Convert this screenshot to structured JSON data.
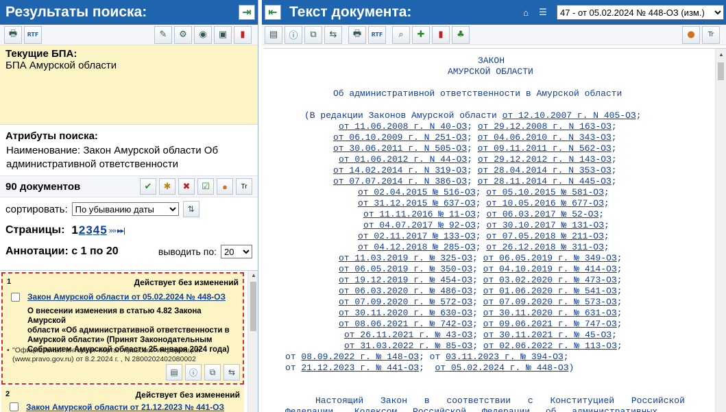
{
  "left": {
    "title": "Результаты поиска:",
    "bpa_label": "Текущие БПА:",
    "bpa_value": "БПА Амурской области",
    "attrs_label": "Атрибуты поиска:",
    "attrs_value_1": "Наименование: Закон Амурской области Об",
    "attrs_value_2": "административной ответственности",
    "count": "90 документов",
    "sort_label": "сортировать:",
    "sort_value": "По убыванию даты",
    "pages_label": "Страницы:",
    "pages": [
      "1",
      "2",
      "3",
      "4",
      "5"
    ],
    "pages_arrows": "»» ▸▸|",
    "ann_label": "Аннотации: с 1 по 20",
    "per_page_label": "выводить по:",
    "per_page_value": "20"
  },
  "results": [
    {
      "num": "1",
      "status": "Действует без изменений",
      "title": "Закон Амурской области от 05.02.2024 № 448-ОЗ",
      "desc_1": "О внесении изменения в статью 4.82 Закона Амурской",
      "desc_2": "области «Об административной ответственности в",
      "desc_3": "Амурской области» (Принят Законодательным",
      "desc_4": "Собранием Амурской области 25 января 2024 года)",
      "src_1": "\"Официальный интернет-портал правовой информации\"",
      "src_2": "(www.pravo.gov.ru) от 8.2.2024 г. , N 2800202402080002"
    },
    {
      "num": "2",
      "status": "Действует без изменений",
      "title": "Закон Амурской области от 21.12.2023 № 441-ОЗ"
    }
  ],
  "right": {
    "title": "Текст документа:",
    "doc_select": "47 - от 05.02.2024 № 448-ОЗ (изм.)",
    "law_title_1": "ЗАКОН",
    "law_title_2": "АМУРСКОЙ ОБЛАСТИ",
    "law_name": "Об административной ответственности в Амурской области",
    "editions_prefix": "(В редакции Законов Амурской области ",
    "editions": [
      "от 12.10.2007 г. N 405-ОЗ",
      "от 11.06.2008 г. N 40-ОЗ",
      "от 29.12.2008 г. N 163-ОЗ",
      "от 06.10.2009 г. N 251-ОЗ",
      "от 04.06.2010 г. N 343-ОЗ",
      "от 30.06.2011 г. N 505-ОЗ",
      "от 09.11.2011 г. N 562-ОЗ",
      "от 01.06.2012 г. N 44-ОЗ",
      "от 29.12.2012 г. N 143-ОЗ",
      "от 14.02.2014 г. N 319-ОЗ",
      "от 28.04.2014 г. N 353-ОЗ",
      "от 07.07.2014 г. N 386-ОЗ",
      "от 28.11.2014 г. N 445-ОЗ",
      "от 02.04.2015 № 516-ОЗ",
      "от 05.10.2015 № 581-ОЗ",
      "от 31.12.2015 № 637-ОЗ",
      "от 10.05.2016 № 677-ОЗ",
      "от 11.11.2016 № 11-ОЗ",
      "от 06.03.2017 № 52-ОЗ",
      "от 04.07.2017 № 92-ОЗ",
      "от 30.10.2017 № 131-ОЗ",
      "от 02.11.2017 № 133-ОЗ",
      "от 07.05.2018 № 211-ОЗ",
      "от 04.12.2018 № 285-ОЗ",
      "от 26.12.2018 № 311-ОЗ",
      "от 11.03.2019 г. № 325-ОЗ",
      "от 06.05.2019 г. № 349-ОЗ",
      "от 06.05.2019 г. № 350-ОЗ",
      "от 04.10.2019 г. № 414-ОЗ",
      "от 19.12.2019 г. № 454-ОЗ",
      "от 03.02.2020 г. № 473-ОЗ",
      "от 06.03.2020 г. № 486-ОЗ",
      "от 01.06.2020 г. № 541-ОЗ",
      "от 07.09.2020 г. № 572-ОЗ",
      "от 07.09.2020 г. № 573-ОЗ",
      "от 30.11.2020 г. № 630-ОЗ",
      "от 30.11.2020 г. № 631-ОЗ",
      "от 08.06.2021 г. № 742-ОЗ",
      "от 09.06.2021 г. № 747-ОЗ",
      "от 26.11.2021 г. № 43-ОЗ",
      "от 30.11.2021 г. № 45-ОЗ",
      "от 31.03.2022 г. № 85-ОЗ",
      "от 02.06.2022 г. № 113-ОЗ",
      "08.09.2022 г. № 148-ОЗ",
      "03.11.2023 г. № 394-ОЗ",
      "21.12.2023 г. № 441-ОЗ",
      "от 05.02.2024 г. № 448-ОЗ"
    ],
    "word_ot": "от",
    "body_line_1": "Настоящий Закон в соответствии с Конституцией Российской",
    "body_line_2": "Федерации, Кодексом Российской Федерации об административных"
  },
  "icons": {
    "left_toolbar": [
      "printer-icon",
      "rtf-export-icon",
      "edit-icon",
      "settings-icon",
      "database-icon",
      "window-icon",
      "bookmark-icon"
    ],
    "right_toolbar": [
      "document-icon",
      "info-icon",
      "links-icon",
      "compare-icon",
      "printer-icon",
      "rtf-export-icon",
      "find-icon",
      "add-icon",
      "bookmark-add-icon",
      "tree-icon",
      "palette-icon"
    ]
  }
}
